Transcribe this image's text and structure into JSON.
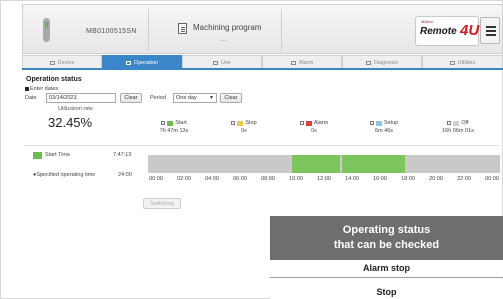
{
  "header": {
    "serial": "MB0100515SN",
    "program_label": "Machining program",
    "program_sub": "---",
    "logo_small": "4Dmm",
    "logo_text": "Remote",
    "logo_four": "4U"
  },
  "tabs": [
    {
      "label": "Device",
      "icon": "list-icon",
      "active": false
    },
    {
      "label": "Operation",
      "icon": "chart-icon",
      "active": true
    },
    {
      "label": "Use",
      "icon": "lock-icon",
      "active": false
    },
    {
      "label": "Alarm",
      "icon": "warning-icon",
      "active": false
    },
    {
      "label": "Diagnosis",
      "icon": "document-icon",
      "active": false
    },
    {
      "label": "Utilities",
      "icon": "gear-icon",
      "active": false
    }
  ],
  "content": {
    "title": "Operation status",
    "enter_dates": "Enter dates",
    "date_label": "Date",
    "date_value": "03/14/2023",
    "clear_label": "Clear",
    "period_label": "Period",
    "period_value": "One day",
    "clear2_label": "Clear",
    "util_label": "Utilization rate",
    "util_value": "32.45%",
    "start_time_label": "Start Time",
    "start_time_value": "7:47:13",
    "spec_label": "●Specified operating time",
    "spec_value": "24:00",
    "switching_label": "Switching"
  },
  "legend": [
    {
      "label": "Start",
      "value": "7h 47m 13s",
      "color": "#6abf4b"
    },
    {
      "label": "Stop",
      "value": "0s",
      "color": "#f2c84b"
    },
    {
      "label": "Alarm",
      "value": "0s",
      "color": "#d9413a"
    },
    {
      "label": "Setup",
      "value": "6m 46s",
      "color": "#8fc3ea"
    },
    {
      "label": "Off",
      "value": "16h 06m 01s",
      "color": "#d0d0d0"
    }
  ],
  "timeline": {
    "ticks": [
      "00:00",
      "02:00",
      "04:00",
      "06:00",
      "08:00",
      "10:00",
      "12:00",
      "14:00",
      "16:00",
      "18:00",
      "20:00",
      "22:00",
      "00:00"
    ],
    "segments": [
      {
        "start_hour": 9.8,
        "end_hour": 13.1
      },
      {
        "start_hour": 13.2,
        "end_hour": 17.5
      }
    ],
    "off_color": "#c9c9c9",
    "on_color": "#7cc65d"
  },
  "overlay": {
    "line1": "Operating status",
    "line2": "that can be checked",
    "row1": "Alarm stop",
    "row2": "Stop"
  }
}
